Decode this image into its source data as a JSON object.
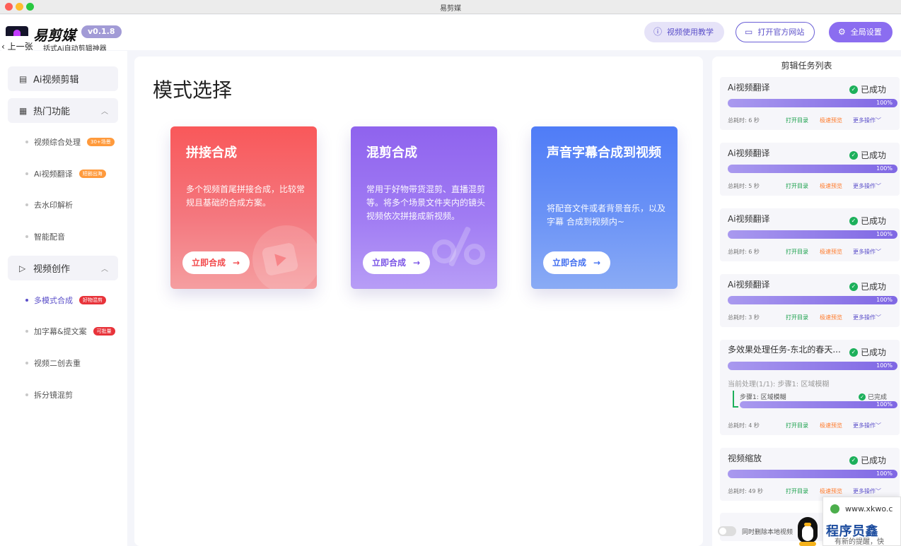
{
  "window": {
    "title": "易剪媒"
  },
  "header": {
    "logo_text": "易剪媒",
    "version": "v0.1.8",
    "subtitle": "括式Ai自动剪辑神器",
    "back_label": "上一张",
    "help_label": "视频使用教学",
    "site_label": "打开官方网站",
    "settings_label": "全局设置"
  },
  "sidebar": {
    "group1": {
      "label": "Ai视频剪辑"
    },
    "group2": {
      "label": "热门功能"
    },
    "hot_items": [
      {
        "label": "视频综合处理",
        "tag": "30+场景"
      },
      {
        "label": "Ai视频翻译",
        "tag": "短剧出海"
      },
      {
        "label": "去水印解析"
      },
      {
        "label": "智能配音"
      }
    ],
    "group3": {
      "label": "视频创作"
    },
    "create_items": [
      {
        "label": "多模式合成",
        "tag": "好物混剪"
      },
      {
        "label": "加字幕&提文案",
        "tag": "可批量"
      },
      {
        "label": "视频二创去重"
      },
      {
        "label": "拆分镜混剪"
      }
    ]
  },
  "main": {
    "title": "模式选择",
    "cards": [
      {
        "title": "拼接合成",
        "desc": "多个视频首尾拼接合成，比较常规且基础的合成方案。",
        "button": "立即合成"
      },
      {
        "title": "混剪合成",
        "desc": "常用于好物带货混剪、直播混剪等。将多个场景文件夹内的镜头视频依次拼接成新视频。",
        "button": "立即合成"
      },
      {
        "title": "声音字幕合成到视频",
        "desc": "将配音文件或者背景音乐，以及字幕 合成到视频内~",
        "button": "立即合成"
      }
    ]
  },
  "tasks": {
    "panel_title": "剪辑任务列表",
    "items": [
      {
        "name": "Ai视频翻译",
        "status": "已成功",
        "progress": "100%",
        "elapsed": "总耗时: 6 秒",
        "open": "打开目录",
        "preview": "极速预览",
        "more": "更多操作"
      },
      {
        "name": "Ai视频翻译",
        "status": "已成功",
        "progress": "100%",
        "elapsed": "总耗时: 5 秒",
        "open": "打开目录",
        "preview": "极速预览",
        "more": "更多操作"
      },
      {
        "name": "Ai视频翻译",
        "status": "已成功",
        "progress": "100%",
        "elapsed": "总耗时: 6 秒",
        "open": "打开目录",
        "preview": "极速预览",
        "more": "更多操作"
      },
      {
        "name": "Ai视频翻译",
        "status": "已成功",
        "progress": "100%",
        "elapsed": "总耗时: 3 秒",
        "open": "打开目录",
        "preview": "极速预览",
        "more": "更多操作"
      },
      {
        "name": "多效果处理任务-东北的春天...",
        "status": "已成功",
        "progress": "100%",
        "current": "当前处理(1/1): 步骤1: 区域模糊",
        "step_name": "步骤1: 区域模糊",
        "step_status": "已完成",
        "step_progress": "100%",
        "elapsed": "总耗时: 4 秒",
        "open": "打开目录",
        "preview": "极速预览",
        "more": "更多操作"
      },
      {
        "name": "视频缩放",
        "status": "已成功",
        "progress": "100%",
        "elapsed": "总耗时: 49 秒",
        "open": "打开目录",
        "preview": "极速预览",
        "more": "更多操作"
      }
    ],
    "toggle_label": "同时删除本地视频"
  },
  "watermark": {
    "site": "www.xkwo.c",
    "big": "程序员鑫",
    "small": "有新的提醒，快"
  }
}
